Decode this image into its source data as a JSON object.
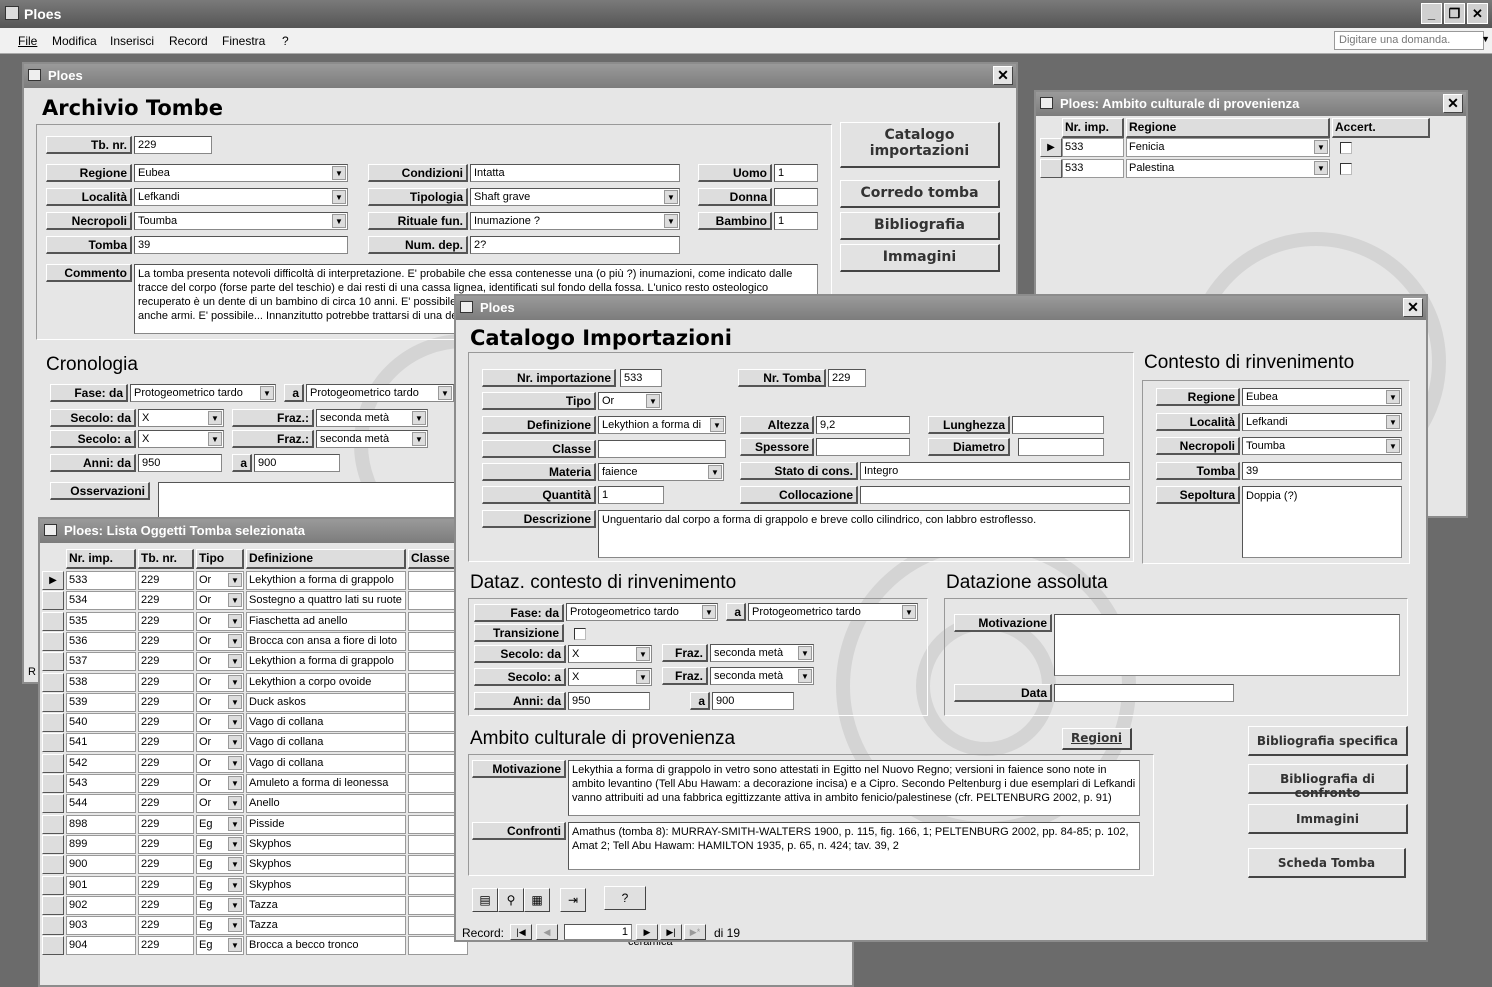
{
  "app": {
    "title": "Ploes",
    "ask_placeholder": "Digitare una domanda."
  },
  "menu": [
    "File",
    "Modifica",
    "Inserisci",
    "Record",
    "Finestra",
    "?"
  ],
  "archivio": {
    "window_title": "Ploes",
    "heading": "Archivio Tombe",
    "tb_nr_label": "Tb. nr.",
    "tb_nr": "229",
    "regione_label": "Regione",
    "regione": "Eubea",
    "localita_label": "Località",
    "localita": "Lefkandi",
    "necropoli_label": "Necropoli",
    "necropoli": "Toumba",
    "tomba_label": "Tomba",
    "tomba": "39",
    "condizioni_label": "Condizioni",
    "condizioni": "Intatta",
    "tipologia_label": "Tipologia",
    "tipologia": "Shaft grave",
    "rituale_label": "Rituale fun.",
    "rituale": "Inumazione ?",
    "num_dep_label": "Num. dep.",
    "num_dep": "2?",
    "uomo_label": "Uomo",
    "uomo": "1",
    "donna_label": "Donna",
    "donna": "",
    "bambino_label": "Bambino",
    "bambino": "1",
    "commento_label": "Commento",
    "commento": "La tomba presenta notevoli difficoltà di interpretazione. E' probabile che essa contenesse una (o più ?) inumazioni, come indicato dalle tracce del corpo (forse parte del teschio) e dai resti di una cassa lignea, identificati sul fondo della fossa. L'unico resto osteologico recuperato è un dente di un bambino di circa 10 anni. E' possibile ricordare la presenza di un bambino (come il carro giocattolo), vi sono anche armi. E' possibile... Innanzitutto potrebbe trattarsi di una deposizione doppia, rituale",
    "btn_catalogo": "Catalogo importazioni",
    "btn_corredo": "Corredo tomba",
    "btn_biblio": "Bibliografia",
    "btn_immagini": "Immagini",
    "cronologia_title": "Cronologia",
    "fase_da_label": "Fase: da",
    "fase_da": "Protogeometrico tardo",
    "a_label": "a",
    "fase_a": "Protogeometrico tardo",
    "secolo_da_label": "Secolo: da",
    "secolo_da": "X",
    "fraz_label": "Fraz.:",
    "fraz1": "seconda metà",
    "secolo_a_label": "Secolo: a",
    "secolo_a": "X",
    "fraz2": "seconda metà",
    "anni_da_label": "Anni: da",
    "anni_da": "950",
    "anni_a": "900",
    "osservazioni_label": "Osservazioni"
  },
  "ambito": {
    "window_title": "Ploes: Ambito culturale di provenienza",
    "cols": [
      "Nr. imp.",
      "Regione",
      "Accert."
    ],
    "rows": [
      {
        "nr": "533",
        "regione": "Fenicia"
      },
      {
        "nr": "533",
        "regione": "Palestina"
      }
    ]
  },
  "lista": {
    "window_title": "Ploes: Lista Oggetti Tomba selezionata",
    "cols": [
      "Nr. imp.",
      "Tb. nr.",
      "Tipo",
      "Definizione",
      "Classe"
    ],
    "rows": [
      {
        "nr": "533",
        "tb": "229",
        "tipo": "Or",
        "def": "Lekythion a forma di grappolo"
      },
      {
        "nr": "534",
        "tb": "229",
        "tipo": "Or",
        "def": "Sostegno a quattro lati su ruote"
      },
      {
        "nr": "535",
        "tb": "229",
        "tipo": "Or",
        "def": "Fiaschetta ad anello"
      },
      {
        "nr": "536",
        "tb": "229",
        "tipo": "Or",
        "def": "Brocca con ansa a fiore di loto"
      },
      {
        "nr": "537",
        "tb": "229",
        "tipo": "Or",
        "def": "Lekythion a forma di grappolo"
      },
      {
        "nr": "538",
        "tb": "229",
        "tipo": "Or",
        "def": "Lekythion a corpo ovoide"
      },
      {
        "nr": "539",
        "tb": "229",
        "tipo": "Or",
        "def": "Duck askos"
      },
      {
        "nr": "540",
        "tb": "229",
        "tipo": "Or",
        "def": "Vago di collana"
      },
      {
        "nr": "541",
        "tb": "229",
        "tipo": "Or",
        "def": "Vago di collana"
      },
      {
        "nr": "542",
        "tb": "229",
        "tipo": "Or",
        "def": "Vago di collana"
      },
      {
        "nr": "543",
        "tb": "229",
        "tipo": "Or",
        "def": "Amuleto a forma di leonessa"
      },
      {
        "nr": "544",
        "tb": "229",
        "tipo": "Or",
        "def": "Anello"
      },
      {
        "nr": "898",
        "tb": "229",
        "tipo": "Eg",
        "def": "Pisside"
      },
      {
        "nr": "899",
        "tb": "229",
        "tipo": "Eg",
        "def": "Skyphos"
      },
      {
        "nr": "900",
        "tb": "229",
        "tipo": "Eg",
        "def": "Skyphos"
      },
      {
        "nr": "901",
        "tb": "229",
        "tipo": "Eg",
        "def": "Skyphos"
      },
      {
        "nr": "902",
        "tb": "229",
        "tipo": "Eg",
        "def": "Tazza"
      },
      {
        "nr": "903",
        "tb": "229",
        "tipo": "Eg",
        "def": "Tazza"
      },
      {
        "nr": "904",
        "tb": "229",
        "tipo": "Eg",
        "def": "Brocca a becco tronco"
      }
    ],
    "edge_left": "R",
    "edge_bottom": "ceramica"
  },
  "catalogo": {
    "window_title": "Ploes",
    "heading": "Catalogo Importazioni",
    "nr_imp_label": "Nr. importazione",
    "nr_imp": "533",
    "nr_tomba_label": "Nr. Tomba",
    "nr_tomba": "229",
    "tipo_label": "Tipo",
    "tipo": "Or",
    "definizione_label": "Definizione",
    "definizione": "Lekythion a forma di",
    "altezza_label": "Altezza",
    "altezza": "9,2",
    "lunghezza_label": "Lunghezza",
    "lunghezza": "",
    "classe_label": "Classe",
    "classe": "",
    "spessore_label": "Spessore",
    "spessore": "",
    "diametro_label": "Diametro",
    "diametro": "",
    "materia_label": "Materia",
    "materia": "faience",
    "stato_label": "Stato di cons.",
    "stato": "Integro",
    "quantita_label": "Quantità",
    "quantita": "1",
    "collocazione_label": "Collocazione",
    "collocazione": "",
    "descrizione_label": "Descrizione",
    "descrizione": "Unguentario dal corpo a forma di grappolo e breve collo cilindrico, con labbro estroflesso.",
    "contesto_title": "Contesto di rinvenimento",
    "c_regione_label": "Regione",
    "c_regione": "Eubea",
    "c_localita_label": "Località",
    "c_localita": "Lefkandi",
    "c_necropoli_label": "Necropoli",
    "c_necropoli": "Toumba",
    "c_tomba_label": "Tomba",
    "c_tomba": "39",
    "c_sepoltura_label": "Sepoltura",
    "c_sepoltura": "Doppia (?)",
    "dataz_title": "Dataz. contesto di rinvenimento",
    "fase_da_label": "Fase: da",
    "fase_da": "Protogeometrico tardo",
    "a_label": "a",
    "fase_a": "Protogeometrico tardo",
    "transizione_label": "Transizione",
    "secolo_da_label": "Secolo: da",
    "secolo_da": "X",
    "fraz_label": "Fraz.",
    "fraz1": "seconda metà",
    "secolo_a_label": "Secolo: a",
    "secolo_a": "X",
    "fraz2": "seconda metà",
    "anni_da_label": "Anni: da",
    "anni_da": "950",
    "anni_a": "900",
    "assoluta_title": "Datazione assoluta",
    "motivazione_label": "Motivazione",
    "data_label": "Data",
    "ambito_title": "Ambito culturale di provenienza",
    "regioni_btn": "Regioni",
    "mot_label": "Motivazione",
    "motivazione": "Lekythia a forma di grappolo in vetro sono attestati in Egitto nel Nuovo Regno; versioni in faience sono note in ambito levantino (Tell Abu Hawam: a decorazione incisa) e a Cipro. Secondo Peltenburg i due esemplari di Lefkandi vanno attribuiti ad una fabbrica egittizzante attiva in ambito fenicio/palestinese (cfr. PELTENBURG 2002, p. 91)",
    "confronti_label": "Confronti",
    "confronti": "Amathus (tomba 8): MURRAY-SMITH-WALTERS 1900, p. 115, fig. 166, 1; PELTENBURG 2002, pp. 84-85; p. 102, Amat 2; Tell Abu Hawam: HAMILTON 1935, p. 65, n. 424; tav. 39, 2",
    "btn_biblio_spec": "Bibliografia specifica",
    "btn_biblio_conf": "Bibliografia di confronto",
    "btn_immagini": "Immagini",
    "btn_scheda": "Scheda Tomba",
    "record_label": "Record:",
    "record_num": "1",
    "record_of": "di 19"
  }
}
